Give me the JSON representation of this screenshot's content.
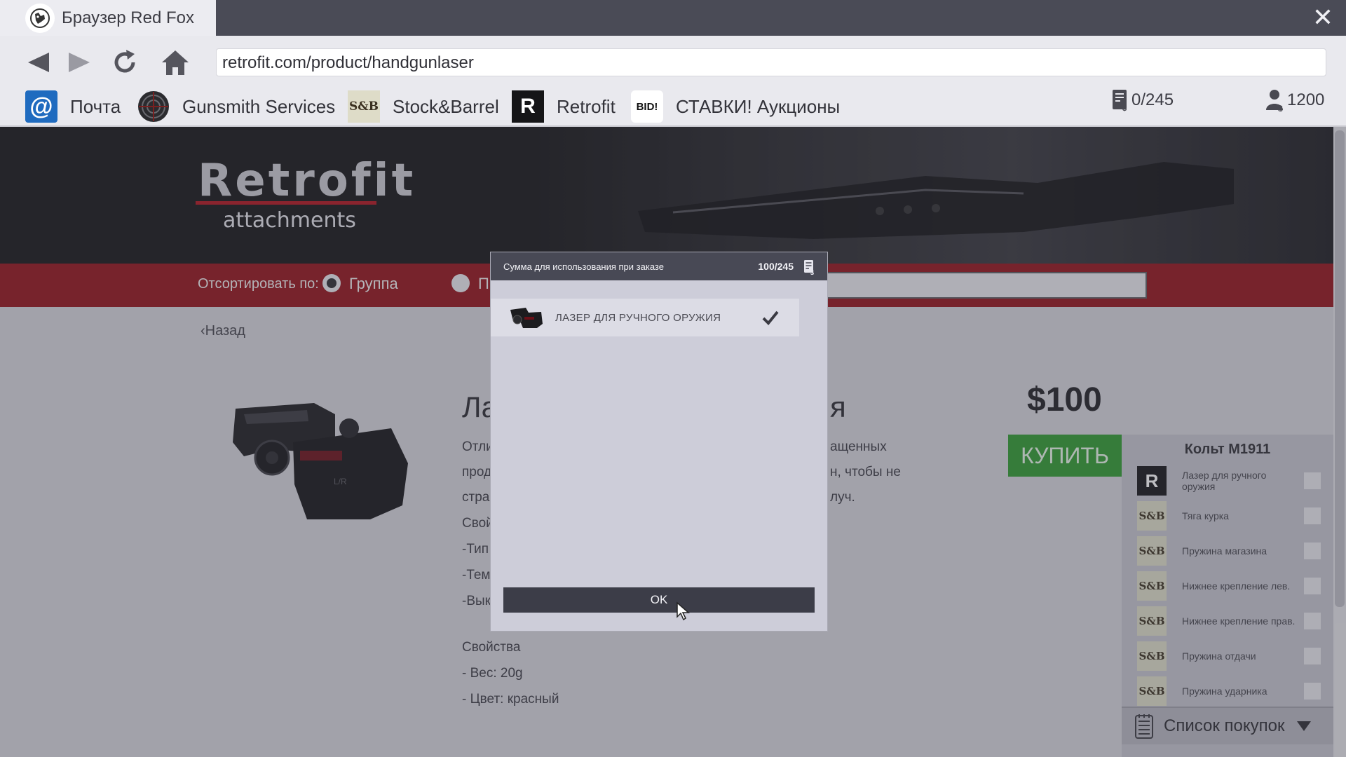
{
  "browser": {
    "tab_title": "Браузер Red Fox",
    "url": "retrofit.com/product/handgunlaser"
  },
  "bookmarks": [
    {
      "label": "Почта",
      "icon": "mail-icon"
    },
    {
      "label": "Gunsmith Services",
      "icon": "target-icon"
    },
    {
      "label": "Stock&Barrel",
      "icon": "stock-barrel-logo-icon"
    },
    {
      "label": "Retrofit",
      "icon": "retrofit-logo-icon"
    },
    {
      "label": "СТАВКИ! Аукционы",
      "icon": "bid-icon",
      "icon_text": "BID!"
    }
  ],
  "counters": {
    "order_budget": "0/245",
    "balance": "1200"
  },
  "site": {
    "logo_main": "Retrofit",
    "logo_sub": "attachments",
    "sort_label": "Отсортировать по:",
    "sort_option_1": "Группа",
    "sort_option_2_partial": "П",
    "back_link": "Назад"
  },
  "product": {
    "title_left": "Ла",
    "title_right": "я",
    "desc_left": [
      "Отли",
      "прод",
      "стра",
      "Свой",
      "-Тип",
      "-Тем",
      "-Вык"
    ],
    "desc_right": [
      "ащенных",
      "н, чтобы не",
      "луч."
    ],
    "props_header": "Свойства",
    "prop_weight": "- Вес: 20g",
    "prop_color": "- Цвет: красный",
    "price": "$100",
    "buy_label": "КУПИТЬ"
  },
  "shopping_list": {
    "title": "Кольт М1911",
    "items": [
      {
        "label": "Лазер для ручного оружия",
        "icon": "retrofit-logo-icon",
        "icon_text": "R",
        "checked": false
      },
      {
        "label": "Тяга курка",
        "icon": "stock-barrel-logo-icon",
        "icon_text": "S&B",
        "checked": false
      },
      {
        "label": "Пружина магазина",
        "icon": "stock-barrel-logo-icon",
        "icon_text": "S&B",
        "checked": false
      },
      {
        "label": "Нижнее крепление лев.",
        "icon": "stock-barrel-logo-icon",
        "icon_text": "S&B",
        "checked": false
      },
      {
        "label": "Нижнее крепление прав.",
        "icon": "stock-barrel-logo-icon",
        "icon_text": "S&B",
        "checked": false
      },
      {
        "label": "Пружина отдачи",
        "icon": "stock-barrel-logo-icon",
        "icon_text": "S&B",
        "checked": false
      },
      {
        "label": "Пружина ударника",
        "icon": "stock-barrel-logo-icon",
        "icon_text": "S&B",
        "checked": false
      }
    ],
    "footer_label": "Список покупок"
  },
  "modal": {
    "title": "Сумма для использования при заказе",
    "count": "100/245",
    "item_label": "ЛАЗЕР ДЛЯ РУЧНОГО ОРУЖИЯ",
    "item_checked": true,
    "ok_label": "OK"
  },
  "colors": {
    "accent_red": "#931119",
    "buy_green": "#2e9a2e",
    "chrome_dark": "#4a4b56"
  }
}
